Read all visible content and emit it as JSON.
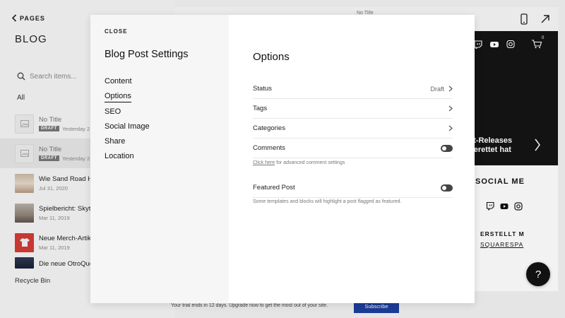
{
  "sidebar": {
    "back_label": "PAGES",
    "title": "BLOG",
    "search_placeholder": "Search items...",
    "filter_label": "All",
    "posts": [
      {
        "title": "No Title",
        "badge": "DRAFT",
        "date": "Yesterday 2"
      },
      {
        "title": "No Title",
        "badge": "DRAFT",
        "date": "Yesterday 2"
      },
      {
        "title": "Wie Sand Road H",
        "date": "Jul 31, 2020"
      },
      {
        "title": "Spielbericht: Skyt",
        "date": "Mar 11, 2019"
      },
      {
        "title": "Neue Merch-Artik",
        "date": "Mar 11, 2019"
      },
      {
        "title": "Die neue OtroQue"
      }
    ],
    "recycle_label": "Recycle Bin"
  },
  "preview": {
    "top_title": "No Title",
    "cart_count": "0",
    "hero_text_line1": "st-Releases",
    "hero_text_line2": "gerettet hat",
    "social_heading": "SOCIAL ME",
    "footer_made": "ERSTELLT M",
    "footer_link": "SQUARESPA",
    "help_label": "?"
  },
  "trial": {
    "text": "Your trial ends in 12 days. Upgrade now to get the most out of your site.",
    "subscribe_label": "Subscribe"
  },
  "modal": {
    "close_label": "CLOSE",
    "title": "Blog Post Settings",
    "nav": [
      "Content",
      "Options",
      "SEO",
      "Social Image",
      "Share",
      "Location"
    ],
    "active_nav": "Options",
    "options": {
      "heading": "Options",
      "status_label": "Status",
      "status_value": "Draft",
      "tags_label": "Tags",
      "categories_label": "Categories",
      "comments_label": "Comments",
      "comments_enabled": false,
      "comments_help_link": "Click here",
      "comments_help_text": " for advanced comment settings",
      "featured_label": "Featured Post",
      "featured_enabled": false,
      "featured_help": "Some templates and blocks will highlight a post flagged as featured."
    }
  },
  "colors": {
    "subscribe_bg": "#1d3f9e",
    "modal_sidebar_bg": "#f6f6f6",
    "site_dark_bg": "#151515"
  }
}
